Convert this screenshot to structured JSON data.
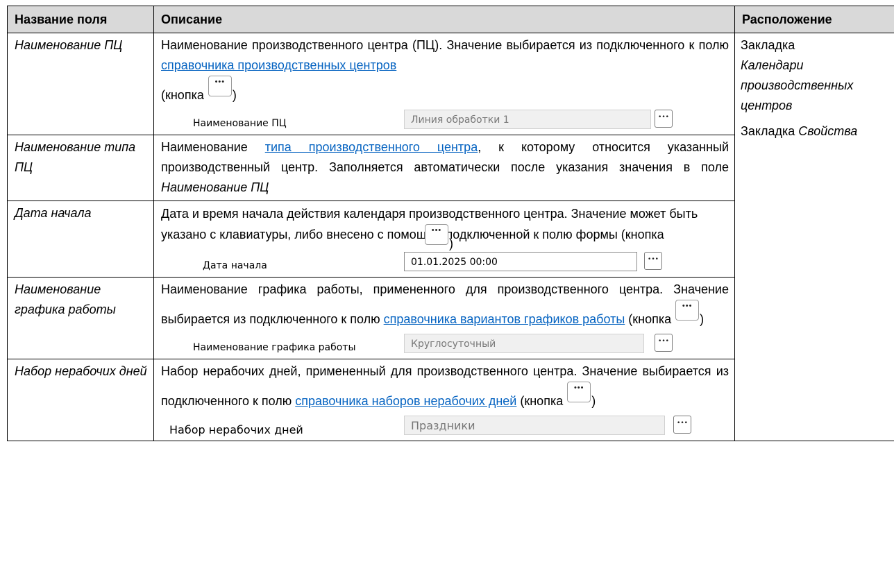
{
  "table": {
    "headers": {
      "name": "Название поля",
      "description": "Описание",
      "location": "Расположение"
    },
    "rows": [
      {
        "name": "Наименование ПЦ",
        "desc_before_link": "Наименование производственного центра (ПЦ). Значение выбирается из подключенного к полю ",
        "link": "справочника производственных центров",
        "desc_after_link": "(кнопка ",
        "desc_close": ")",
        "field": {
          "label": "Наименование ПЦ",
          "value": "Линия обработки 1"
        }
      },
      {
        "name": "Наименование типа ПЦ",
        "desc_before_link": "Наименование ",
        "link": "типа производственного центра",
        "desc_after_link": ", к которому относится указанный производственный центр. Заполняется автоматически после указания значения в поле ",
        "desc_italic": "Наименование ПЦ"
      },
      {
        "name": "Дата начала",
        "desc_text": "Дата и время начала действия календаря производственного центра. Значение может быть указано с клавиатуры, либо внесено с помощью подключенной к полю формы (кнопка ",
        "desc_close": ")",
        "field": {
          "label": "Дата начала",
          "value": "01.01.2025 00:00"
        }
      },
      {
        "name": "Наименование графика работы",
        "desc_before_link": "Наименование графика работы, примененного для производственного центра. Значение выбирается из подключенного к полю ",
        "link": "справочника вариантов графиков работы",
        "desc_after_link": " (кнопка ",
        "desc_close": ")",
        "field": {
          "label": "Наименование графика работы",
          "value": "Круглосуточный"
        }
      },
      {
        "name": "Набор нерабочих дней",
        "desc_before_link": "Набор нерабочих дней, примененный для производственного центра. Значение выбирается из подключенного к полю ",
        "link": "справочника наборов нерабочих дней",
        "desc_after_link": " (кнопка ",
        "desc_close": ")",
        "field": {
          "label": "Набор нерабочих дней",
          "value": "Праздники"
        }
      }
    ],
    "location": {
      "line1_prefix": "Закладка",
      "line1_italic": "Календари производственных центров",
      "line2_prefix": "Закладка ",
      "line2_italic": "Свойства"
    }
  }
}
